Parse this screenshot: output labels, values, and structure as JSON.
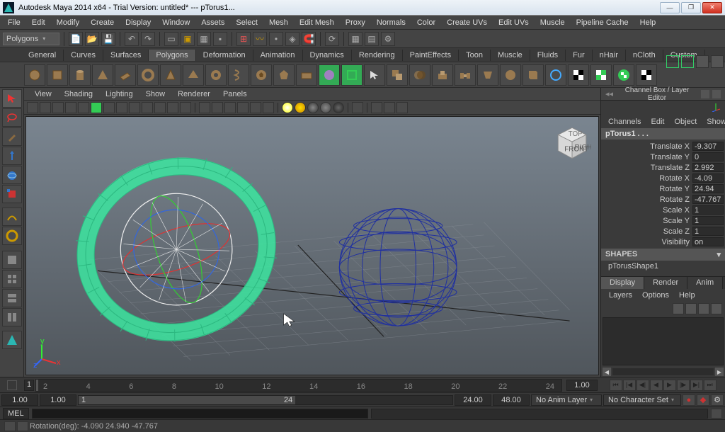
{
  "titlebar": {
    "title": "Autodesk Maya 2014 x64 - Trial Version: untitled*  ---  pTorus1..."
  },
  "main_menu": [
    "File",
    "Edit",
    "Modify",
    "Create",
    "Display",
    "Window",
    "Assets",
    "Select",
    "Mesh",
    "Edit Mesh",
    "Proxy",
    "Normals",
    "Color",
    "Create UVs",
    "Edit UVs",
    "Muscle",
    "Pipeline Cache",
    "Help"
  ],
  "module_dropdown": "Polygons",
  "shelf_tabs": [
    "General",
    "Curves",
    "Surfaces",
    "Polygons",
    "Deformation",
    "Animation",
    "Dynamics",
    "Rendering",
    "PaintEffects",
    "Toon",
    "Muscle",
    "Fluids",
    "Fur",
    "nHair",
    "nCloth",
    "Custom"
  ],
  "shelf_active_tab": "Polygons",
  "panel_menu": [
    "View",
    "Shading",
    "Lighting",
    "Show",
    "Renderer",
    "Panels"
  ],
  "channel_box": {
    "header": "Channel Box / Layer Editor",
    "menubar": [
      "Channels",
      "Edit",
      "Object",
      "Show"
    ],
    "object_name": "pTorus1 . . .",
    "attributes": [
      {
        "label": "Translate X",
        "value": "-9.307"
      },
      {
        "label": "Translate Y",
        "value": "0"
      },
      {
        "label": "Translate Z",
        "value": "2.992"
      },
      {
        "label": "Rotate X",
        "value": "-4.09"
      },
      {
        "label": "Rotate Y",
        "value": "24.94"
      },
      {
        "label": "Rotate Z",
        "value": "-47.767"
      },
      {
        "label": "Scale X",
        "value": "1"
      },
      {
        "label": "Scale Y",
        "value": "1"
      },
      {
        "label": "Scale Z",
        "value": "1"
      },
      {
        "label": "Visibility",
        "value": "on"
      }
    ],
    "shapes_head": "SHAPES",
    "shape_name": "pTorusShape1",
    "layer_tabs": [
      "Display",
      "Render",
      "Anim"
    ],
    "layer_tab_active": "Display",
    "layer_menu": [
      "Layers",
      "Options",
      "Help"
    ]
  },
  "timeline": {
    "current": "1",
    "ticks": [
      "2",
      "4",
      "6",
      "8",
      "10",
      "12",
      "14",
      "16",
      "18",
      "20",
      "22",
      "24"
    ],
    "end_display": "1.00",
    "range_start": "1.00",
    "range_in": "1.00",
    "range_thumb_start": "1",
    "range_thumb_end": "24",
    "range_out": "24.00",
    "range_end": "48.00",
    "anim_layer": "No Anim Layer",
    "char_set": "No Character Set"
  },
  "cmdline": {
    "lang": "MEL"
  },
  "helpline": {
    "text": "Rotation(deg):    -4.090    24.940    -47.767"
  },
  "viewcube": {
    "front": "FRONT",
    "right": "RIGHT",
    "top": "TOP"
  }
}
